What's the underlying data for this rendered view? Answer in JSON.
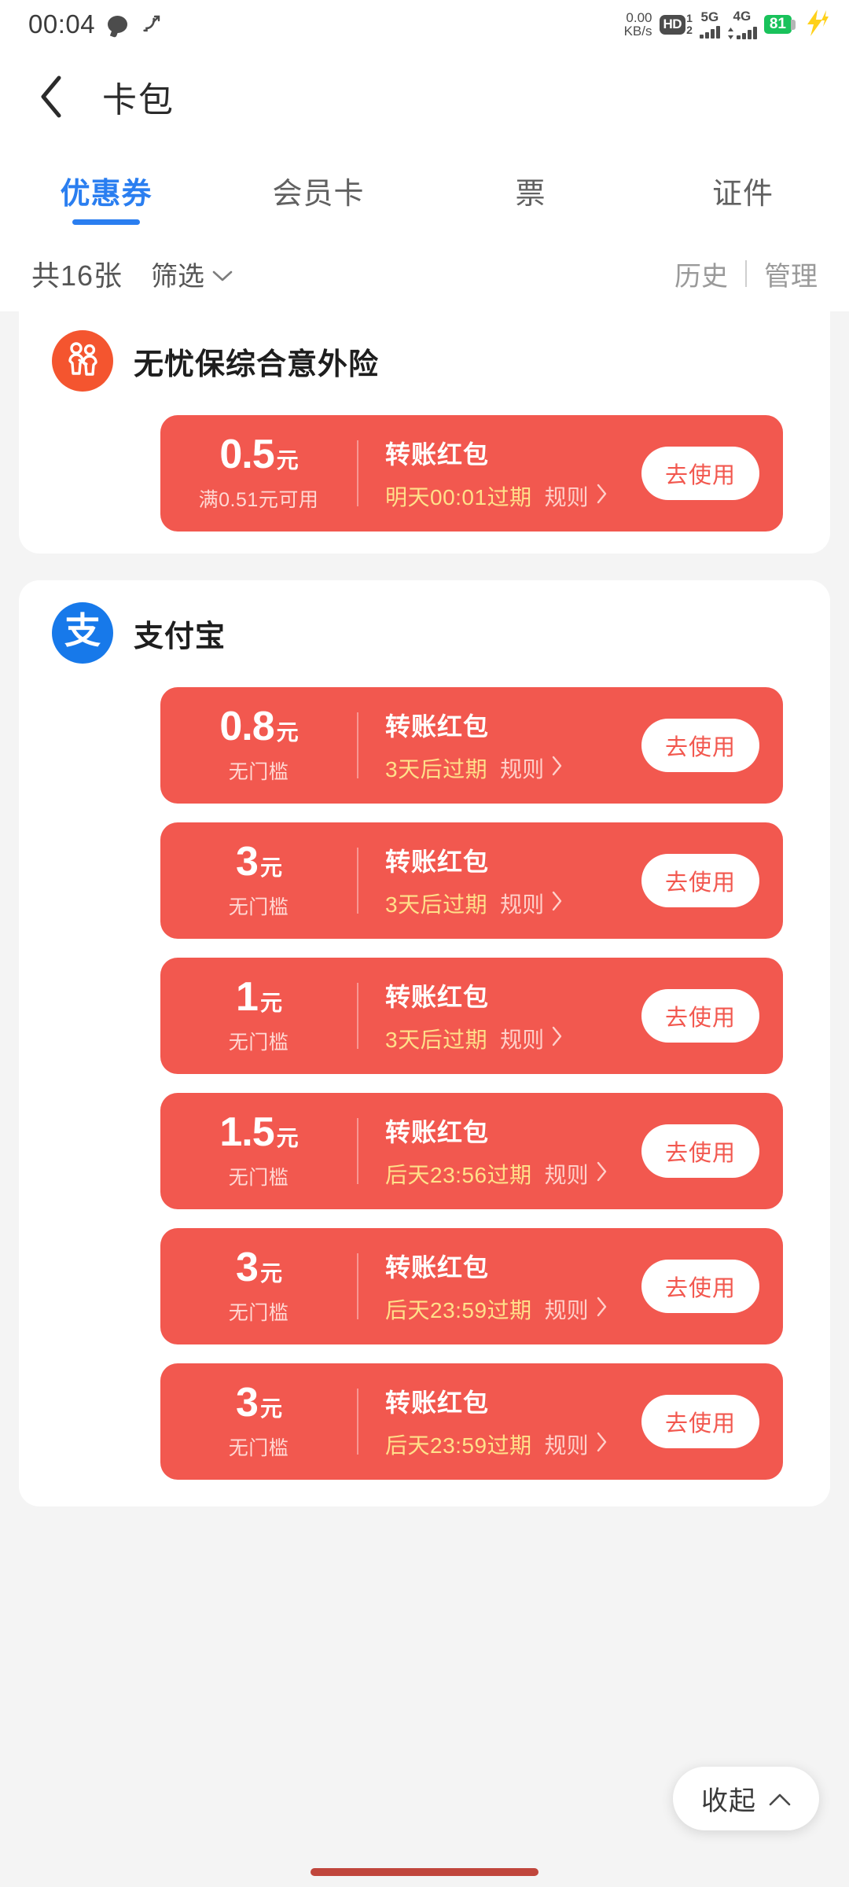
{
  "status_bar": {
    "time": "00:04",
    "message_icon": "message-bubble-icon",
    "call_icon": "missed-call-icon",
    "net_speed_value": "0.00",
    "net_speed_unit": "KB/s",
    "hd_label": "HD",
    "hd_sup": "1",
    "hd_sub": "2",
    "sim1_network": "5G",
    "sim2_network": "4G",
    "battery_level": "81",
    "charging": true,
    "battery_color": "#19c25b"
  },
  "header": {
    "back_icon": "back-chevron-icon",
    "title": "卡包"
  },
  "tabs": {
    "active_index": 0,
    "accent_color": "#2a7ef0",
    "items": [
      {
        "label": "优惠券"
      },
      {
        "label": "会员卡"
      },
      {
        "label": "票"
      },
      {
        "label": "证件"
      }
    ]
  },
  "filter_bar": {
    "count_label": "共16张",
    "filter_label": "筛选",
    "filter_chevron": "chevron-down-icon",
    "history_label": "历史",
    "manage_label": "管理"
  },
  "coupon_red": "#f2584f",
  "groups": [
    {
      "merchant": "无忧保综合意外险",
      "logo_name": "insurance-people-icon",
      "logo_color": "#f4552f",
      "coupons": [
        {
          "amount": "0.5",
          "unit": "元",
          "condition": "满0.51元可用",
          "title": "转账红包",
          "expiry": "明天00:01过期",
          "rule_label": "规则",
          "rule_chevron": "chevron-right-icon",
          "action_label": "去使用"
        }
      ]
    },
    {
      "merchant": "支付宝",
      "logo_name": "alipay-logo-icon",
      "logo_color": "#1779ea",
      "logo_glyph": "支",
      "coupons": [
        {
          "amount": "0.8",
          "unit": "元",
          "condition": "无门槛",
          "title": "转账红包",
          "expiry": "3天后过期",
          "rule_label": "规则",
          "rule_chevron": "chevron-right-icon",
          "action_label": "去使用"
        },
        {
          "amount": "3",
          "unit": "元",
          "condition": "无门槛",
          "title": "转账红包",
          "expiry": "3天后过期",
          "rule_label": "规则",
          "rule_chevron": "chevron-right-icon",
          "action_label": "去使用"
        },
        {
          "amount": "1",
          "unit": "元",
          "condition": "无门槛",
          "title": "转账红包",
          "expiry": "3天后过期",
          "rule_label": "规则",
          "rule_chevron": "chevron-right-icon",
          "action_label": "去使用"
        },
        {
          "amount": "1.5",
          "unit": "元",
          "condition": "无门槛",
          "title": "转账红包",
          "expiry": "后天23:56过期",
          "rule_label": "规则",
          "rule_chevron": "chevron-right-icon",
          "action_label": "去使用"
        },
        {
          "amount": "3",
          "unit": "元",
          "condition": "无门槛",
          "title": "转账红包",
          "expiry": "后天23:59过期",
          "rule_label": "规则",
          "rule_chevron": "chevron-right-icon",
          "action_label": "去使用"
        },
        {
          "amount": "3",
          "unit": "元",
          "condition": "无门槛",
          "title": "转账红包",
          "expiry": "后天23:59过期",
          "rule_label": "规则",
          "rule_chevron": "chevron-right-icon",
          "action_label": "去使用"
        }
      ]
    }
  ],
  "collapse_button": {
    "label": "收起",
    "chevron": "chevron-up-icon"
  }
}
